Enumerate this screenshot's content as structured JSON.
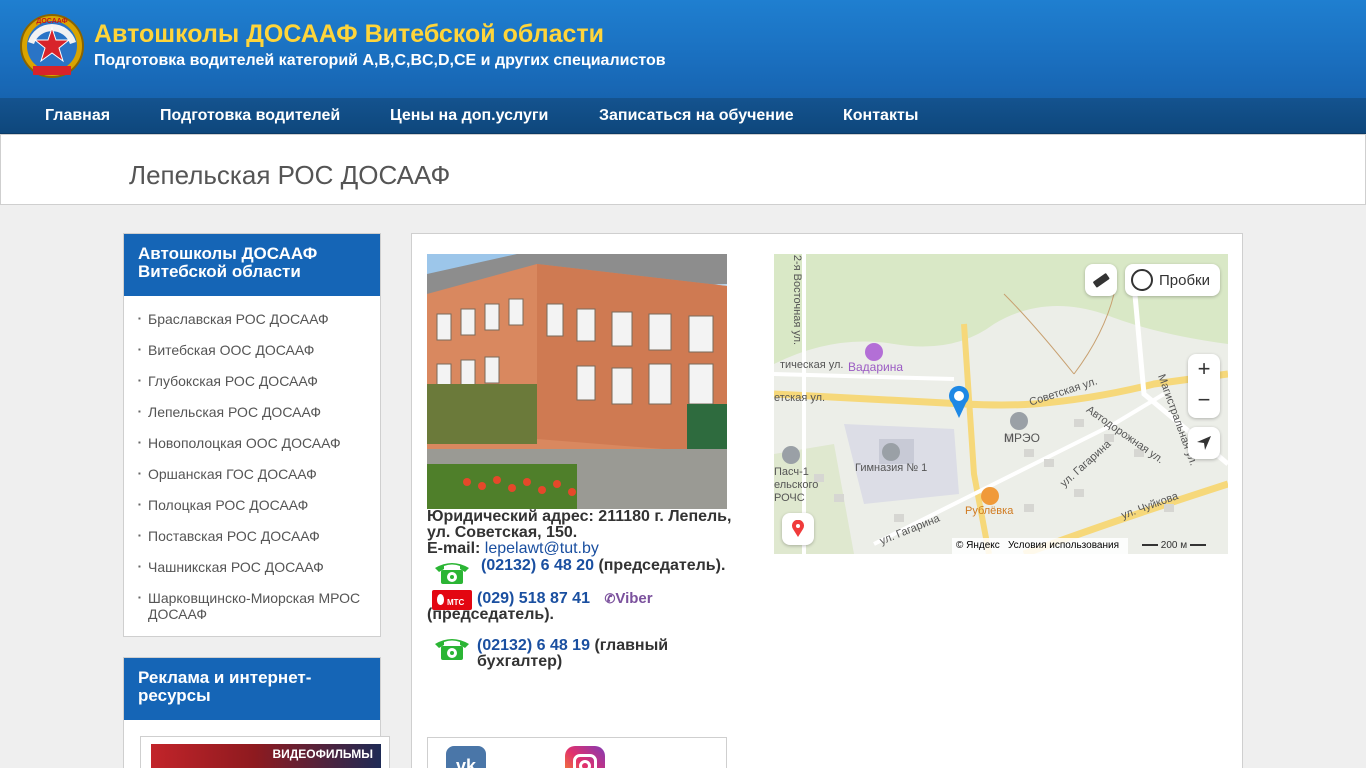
{
  "header": {
    "title": "Автошколы ДОСААФ Витебской области",
    "subtitle": "Подготовка водителей категорий A,B,C,BC,D,CE и других специалистов",
    "logo_text": "ДОСААФ"
  },
  "nav": {
    "items": [
      {
        "label": "Главная"
      },
      {
        "label": "Подготовка водителей"
      },
      {
        "label": "Цены на доп.услуги"
      },
      {
        "label": "Записаться на обучение"
      },
      {
        "label": "Контакты"
      }
    ]
  },
  "page": {
    "title": "Лепельская РОС ДОСААФ"
  },
  "sidebar": {
    "schools_heading": "Автошколы ДОСААФ Витебской области",
    "schools": [
      "Браславская РОС ДОСААФ",
      "Витебская ООС ДОСААФ",
      "Глубокская РОС ДОСААФ",
      "Лепельская РОС ДОСААФ",
      "Новополоцкая ООС ДОСААФ",
      "Оршанская ГОС ДОСААФ",
      "Полоцкая РОС ДОСААФ",
      "Поставская РОС ДОСААФ",
      "Чашникская РОС ДОСААФ",
      "Шарковщинско-Миорская МРОС ДОСААФ"
    ],
    "ads_heading": "Реклама и интернет-ресурсы",
    "ad_banner_text": "ВИДЕОФИЛЬМЫ"
  },
  "contacts": {
    "address": "Юридический адрес: 211180 г. Лепель, ул. Советская, 150.",
    "email_label": "E-mail:",
    "email": "lepelawt@tut.by",
    "phone1": "(02132) 6 48 20",
    "phone1_note": "(председатель).",
    "mts_label": "МТС",
    "phone2": "(029) 518 87 41",
    "viber_label": "Viber",
    "phone2_note": "(председатель).",
    "phone3": "(02132) 6 48 19",
    "phone3_note": "(главный бухгалтер)"
  },
  "map": {
    "traffic_label": "Пробки",
    "copyright": "© Яндекс",
    "terms": "Условия использования",
    "scale": "200 м",
    "places": {
      "vadarina": "Вадарина",
      "mreo": "МРЭО",
      "gymnasium": "Гимназия № 1",
      "rublevka": "Рублёвка",
      "pasch": "Пасч-1",
      "pasch2": "ельского",
      "pasch3": "РОЧС"
    },
    "streets": {
      "sovetskaya": "Советская ул.",
      "sovetskaya_left": "етская ул.",
      "vostochnaya": "2-я Восточная ул.",
      "avtodoroznaya": "Автодорожная ул.",
      "magistralnaya": "Магистральная ул.",
      "gagarina1": "ул. Гагарина",
      "gagarina2": "ул. Гагарина",
      "chuykova": "ул. Чуйкова",
      "tichesk": "тическая ул."
    }
  },
  "colors": {
    "header_bg": "#1a6fbf",
    "title_yellow": "#ffd53a",
    "nav_bg": "#0e477c",
    "sidebar_head": "#1565b6",
    "link": "#1a4fa0"
  }
}
